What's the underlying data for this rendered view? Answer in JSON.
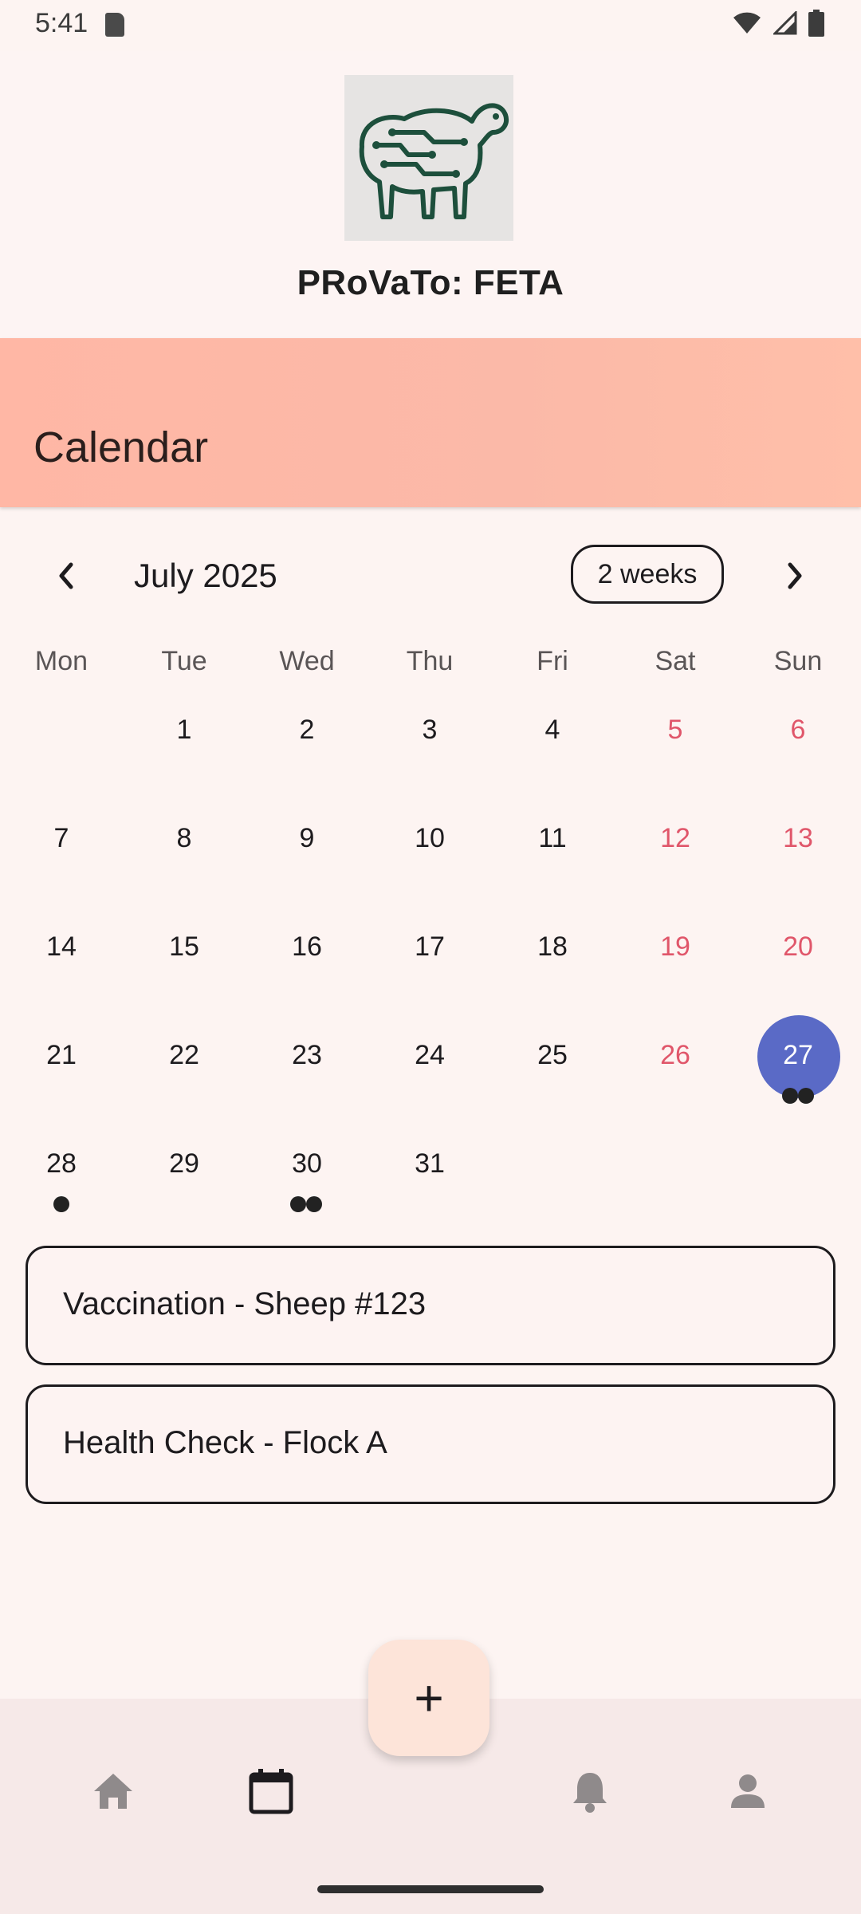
{
  "status": {
    "time": "5:41"
  },
  "app": {
    "title": "PRoVaTo: FETA"
  },
  "appbar": {
    "title": "Calendar"
  },
  "calendar": {
    "month_label": "July 2025",
    "format_button": "2 weeks",
    "weekdays": [
      "Mon",
      "Tue",
      "Wed",
      "Thu",
      "Fri",
      "Sat",
      "Sun"
    ],
    "weeks": [
      [
        "",
        "1",
        "2",
        "3",
        "4",
        "5",
        "6"
      ],
      [
        "7",
        "8",
        "9",
        "10",
        "11",
        "12",
        "13"
      ],
      [
        "14",
        "15",
        "16",
        "17",
        "18",
        "19",
        "20"
      ],
      [
        "21",
        "22",
        "23",
        "24",
        "25",
        "26",
        "27"
      ],
      [
        "28",
        "29",
        "30",
        "31",
        "",
        "",
        ""
      ]
    ],
    "selected_day": "27",
    "event_markers": {
      "27": 2,
      "28": 1,
      "30": 2
    },
    "colors": {
      "selected": "#5a6ac6",
      "weekend": "#e0566a",
      "marker": "#222222"
    }
  },
  "events": [
    {
      "title": "Vaccination - Sheep #123"
    },
    {
      "title": "Health Check - Flock A"
    }
  ],
  "bottom_nav": {
    "items": [
      {
        "icon": "home-icon"
      },
      {
        "icon": "calendar-icon"
      },
      {
        "icon": "bell-icon"
      },
      {
        "icon": "person-icon"
      }
    ],
    "fab_icon": "plus-icon",
    "fab_label": "+"
  }
}
